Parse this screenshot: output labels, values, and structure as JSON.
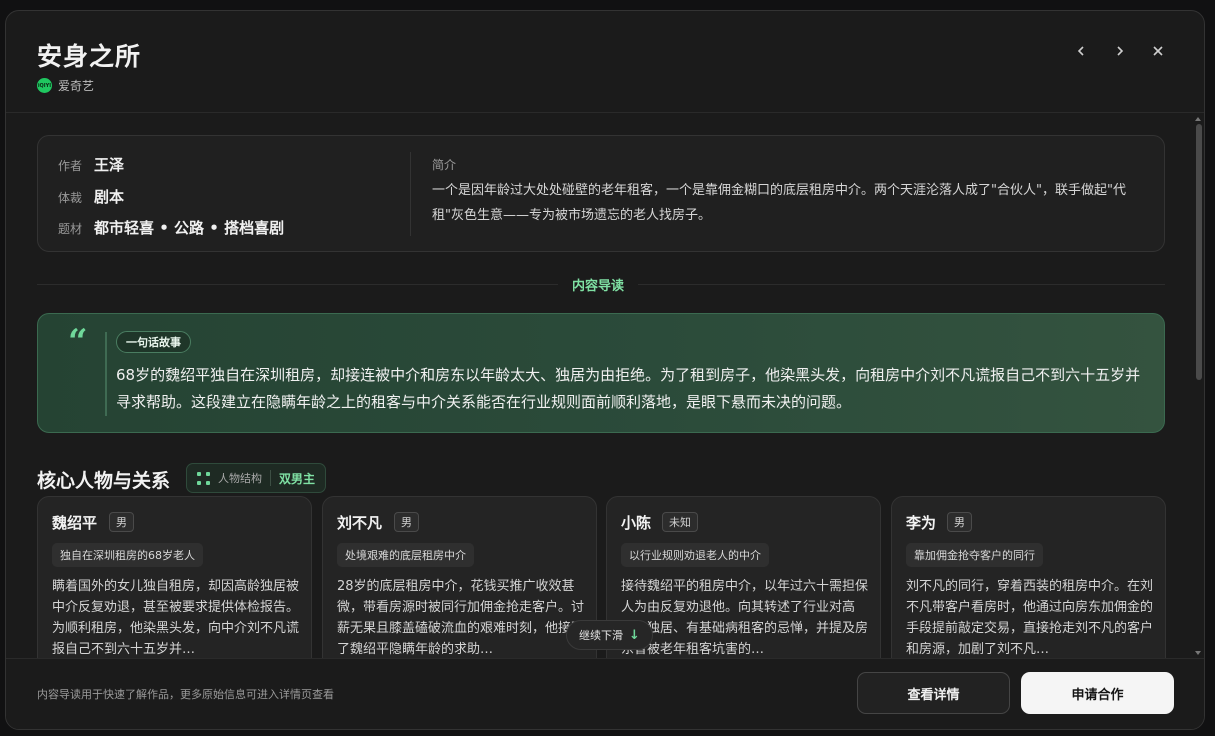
{
  "header": {
    "title": "安身之所",
    "platform_logo_text": "iQIYI",
    "platform_name": "爱奇艺"
  },
  "info": {
    "author_key": "作者",
    "author_val": "王泽",
    "genre_key": "体裁",
    "genre_val": "剧本",
    "theme_key": "题材",
    "theme_val": "都市轻喜 • 公路 • 搭档喜剧",
    "synopsis_label": "简介",
    "synopsis_text": "一个是因年龄过大处处碰壁的老年租客，一个是靠佣金糊口的底层租房中介。两个天涯沦落人成了\"合伙人\"，联手做起\"代租\"灰色生意——专为被市场遗忘的老人找房子。"
  },
  "section_label": "内容导读",
  "logline": {
    "tag": "一句话故事",
    "text": "68岁的魏绍平独自在深圳租房，却接连被中介和房东以年龄太大、独居为由拒绝。为了租到房子，他染黑头发，向租房中介刘不凡谎报自己不到六十五岁并寻求帮助。这段建立在隐瞒年龄之上的租客与中介关系能否在行业规则面前顺利落地，是眼下悬而未决的问题。"
  },
  "characters_section": {
    "title": "核心人物与关系",
    "structure_key": "人物结构",
    "structure_val": "双男主"
  },
  "characters": [
    {
      "name": "魏绍平",
      "gender": "男",
      "role": "独自在深圳租房的68岁老人",
      "desc": "瞒着国外的女儿独自租房，却因高龄独居被中介反复劝退，甚至被要求提供体检报告。为顺利租房，他染黑头发，向中介刘不凡谎报自己不到六十五岁并…"
    },
    {
      "name": "刘不凡",
      "gender": "男",
      "role": "处境艰难的底层租房中介",
      "desc": "28岁的底层租房中介，花钱买推广收效甚微，带看房源时被同行加佣金抢走客户。讨薪无果且膝盖磕破流血的艰难时刻，他接到了魏绍平隐瞒年龄的求助…"
    },
    {
      "name": "小陈",
      "gender": "未知",
      "role": "以行业规则劝退老人的中介",
      "desc": "接待魏绍平的租房中介，以年过六十需担保人为由反复劝退他。向其转述了行业对高龄、独居、有基础病租客的忌惮，并提及房东曾被老年租客坑害的…"
    },
    {
      "name": "李为",
      "gender": "男",
      "role": "靠加佣金抢夺客户的同行",
      "desc": "刘不凡的同行，穿着西装的租房中介。在刘不凡带客户看房时，他通过向房东加佣金的手段提前敲定交易，直接抢走刘不凡的客户和房源，加剧了刘不凡…"
    }
  ],
  "scroll_hint": "继续下滑",
  "footer": {
    "note": "内容导读用于快速了解作品，更多原始信息可进入详情页查看",
    "detail_button": "查看详情",
    "apply_button": "申请合作"
  }
}
